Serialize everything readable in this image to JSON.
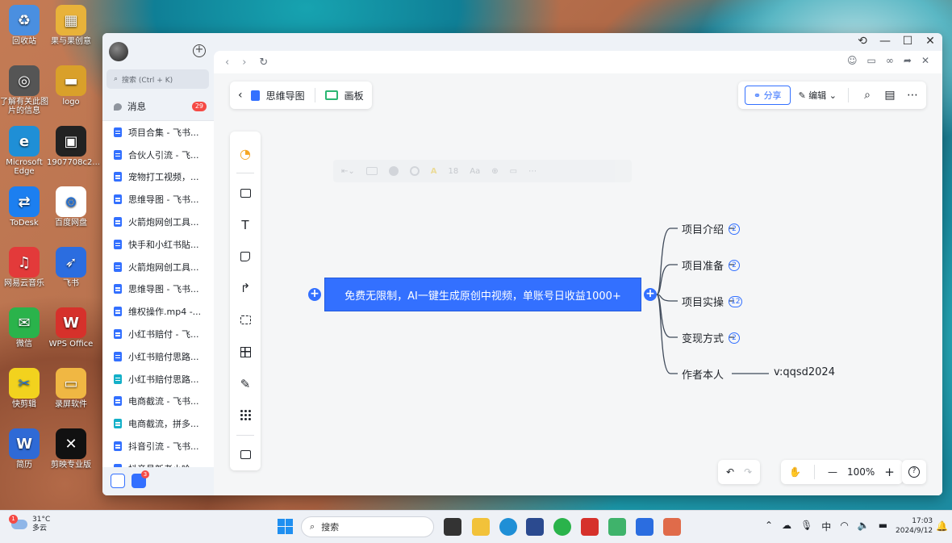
{
  "desktop": {
    "icons": [
      {
        "label": "回收站",
        "color": "#4a8fe0",
        "glyph": "♻"
      },
      {
        "label": "果与果创意",
        "color": "#e8b23a",
        "glyph": "▦"
      },
      {
        "label": "了解有关此图片的信息",
        "color": "#555555",
        "glyph": "◎"
      },
      {
        "label": "logo",
        "color": "#d9a02a",
        "glyph": "▬"
      },
      {
        "label": "Microsoft Edge",
        "color": "#1f8fd6",
        "glyph": "e"
      },
      {
        "label": "1907708c2...",
        "color": "#222222",
        "glyph": "▣"
      },
      {
        "label": "ToDesk",
        "color": "#1c7ff0",
        "glyph": "⇄"
      },
      {
        "label": "百度网盘",
        "color": "#ffffff",
        "glyph": "⊛"
      },
      {
        "label": "网易云音乐",
        "color": "#e33a3a",
        "glyph": "♫"
      },
      {
        "label": "飞书",
        "color": "#2b6de0",
        "glyph": "➶"
      },
      {
        "label": "微信",
        "color": "#2ab34b",
        "glyph": "✉"
      },
      {
        "label": "WPS Office",
        "color": "#d6312b",
        "glyph": "W"
      },
      {
        "label": "快剪辑",
        "color": "#f2d21e",
        "glyph": "✂"
      },
      {
        "label": "录屏软件",
        "color": "#f0b743",
        "glyph": "▭"
      },
      {
        "label": "简历",
        "color": "#2f6ad6",
        "glyph": "W"
      },
      {
        "label": "剪映专业版",
        "color": "#111111",
        "glyph": "✕"
      }
    ]
  },
  "window": {
    "controls": {
      "history": "⟲",
      "minimize": "—",
      "maximize": "☐",
      "close": "✕"
    }
  },
  "sidebar": {
    "add": "+",
    "search_placeholder": "搜索 (Ctrl + K)",
    "messages_label": "消息",
    "messages_badge": "29",
    "docs": [
      {
        "title": "项目合集 - 飞书...",
        "type": "doc"
      },
      {
        "title": "合伙人引流 - 飞...",
        "type": "doc"
      },
      {
        "title": "宠物打工视频，...",
        "type": "doc"
      },
      {
        "title": "思维导图 - 飞书...",
        "type": "doc"
      },
      {
        "title": "火箭炮网创工具...",
        "type": "doc"
      },
      {
        "title": "快手和小红书貼...",
        "type": "doc"
      },
      {
        "title": "火箭炮网创工具...",
        "type": "doc"
      },
      {
        "title": "思维导图 - 飞书...",
        "type": "doc"
      },
      {
        "title": "维权操作.mp4 -...",
        "type": "video"
      },
      {
        "title": "小红书赔付 - 飞...",
        "type": "doc"
      },
      {
        "title": "小红书赔付思路...",
        "type": "doc"
      },
      {
        "title": "小红书赔付思路...",
        "type": "teal"
      },
      {
        "title": "电商截流 - 飞书...",
        "type": "doc"
      },
      {
        "title": "电商截流，拼多...",
        "type": "teal"
      },
      {
        "title": "抖音引流 - 飞书...",
        "type": "doc"
      },
      {
        "title": "抖音号新老小哈...",
        "type": "doc"
      }
    ],
    "footer_badge": "3"
  },
  "browser": {
    "back": "‹",
    "forward": "›",
    "reload": "↻"
  },
  "toolbar": {
    "back": "‹",
    "mindmap_label": "思维导图",
    "whiteboard_label": "画板",
    "share_label": "分享",
    "edit_label": "编辑"
  },
  "tools": {
    "text": "T",
    "connector": "↱",
    "pen": "✎"
  },
  "ghost_toolbar": {
    "font_size": "18"
  },
  "mindmap": {
    "root": "免费无限制，AI一键生成原创中视频，单账号日收益1000+",
    "children": [
      {
        "label": "项目介绍",
        "count": "2"
      },
      {
        "label": "项目准备",
        "count": "2"
      },
      {
        "label": "项目实操",
        "count": "12"
      },
      {
        "label": "变现方式",
        "count": "2"
      },
      {
        "label": "作者本人",
        "leaf": "v:qqsd2024"
      }
    ]
  },
  "bottom": {
    "undo": "↶",
    "redo": "↷",
    "hand": "✋",
    "zoom_out": "—",
    "zoom": "100%",
    "zoom_in": "+",
    "help": "?"
  },
  "taskbar": {
    "weather_temp": "31°C",
    "weather_desc": "多云",
    "weather_badge": "1",
    "search_label": "搜索",
    "ime": "中",
    "time": "17:03",
    "date": "2024/9/12"
  }
}
